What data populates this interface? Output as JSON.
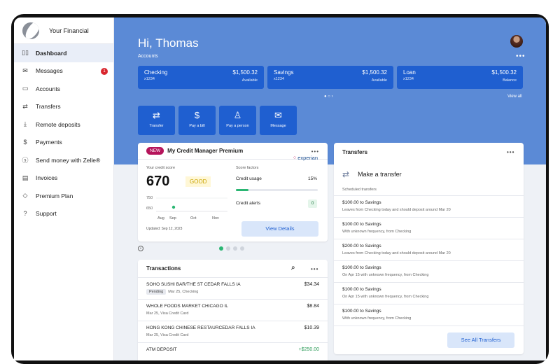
{
  "app": {
    "name": "Your Financial"
  },
  "sidebar": {
    "items": [
      {
        "label": "Dashboard",
        "icon": "dashboard-icon",
        "glyph": "▯▯"
      },
      {
        "label": "Messages",
        "icon": "mail-icon",
        "glyph": "✉",
        "badge": "1"
      },
      {
        "label": "Accounts",
        "icon": "wallet-icon",
        "glyph": "▭"
      },
      {
        "label": "Transfers",
        "icon": "transfer-icon",
        "glyph": "⇄"
      },
      {
        "label": "Remote deposits",
        "icon": "download-icon",
        "glyph": "⤓"
      },
      {
        "label": "Payments",
        "icon": "dollar-doc-icon",
        "glyph": "$"
      },
      {
        "label": "Send money with Zelle®",
        "icon": "zelle-icon",
        "glyph": "ⓢ"
      },
      {
        "label": "Invoices",
        "icon": "invoice-icon",
        "glyph": "▤"
      },
      {
        "label": "Premium Plan",
        "icon": "diamond-icon",
        "glyph": "◇"
      },
      {
        "label": "Support",
        "icon": "help-icon",
        "glyph": "?"
      }
    ]
  },
  "header": {
    "greeting": "Hi, Thomas",
    "accounts_label": "Accounts",
    "more": "•••"
  },
  "accounts": [
    {
      "name": "Checking",
      "id": "x1234",
      "balance": "$1,500.32",
      "sub": "Available"
    },
    {
      "name": "Savings",
      "id": "x1234",
      "balance": "$1,500.32",
      "sub": "Available"
    },
    {
      "name": "Loan",
      "id": "x1234",
      "balance": "$1,500.32",
      "sub": "Balance"
    }
  ],
  "accounts_pager": "● ○ ›",
  "view_all": "View all",
  "quick_actions": [
    {
      "label": "Transfer",
      "icon": "transfer-icon",
      "glyph": "⇄"
    },
    {
      "label": "Pay a bill",
      "icon": "bill-icon",
      "glyph": "$"
    },
    {
      "label": "Pay a person",
      "icon": "person-icon",
      "glyph": "♙"
    },
    {
      "label": "Message",
      "icon": "message-icon",
      "glyph": "✉"
    }
  ],
  "credit": {
    "badge": "NEW",
    "title": "My Credit Manager Premium",
    "brand": "experian",
    "score_label": "Your credit score",
    "score": "670",
    "rating": "GOOD",
    "factors_label": "Score factors",
    "chart": {
      "y_labels": [
        "750",
        "650"
      ],
      "x_labels": [
        "Aug",
        "Sep",
        "Oct",
        "Nov"
      ],
      "point": {
        "month": "Sep",
        "value": 670
      }
    },
    "factors": [
      {
        "name": "Credit usage",
        "value": "15%",
        "fill": 0.15
      },
      {
        "name": "Credit alerts",
        "value": "0"
      }
    ],
    "updated": "Updated: Sep 12, 2023",
    "button": "View Details",
    "pause": "II"
  },
  "transactions": {
    "title": "Transactions",
    "more": "•••",
    "rows": [
      {
        "desc": "SOHO SUSHI BAR/THE ST CEDAR FALLS IA",
        "status": "Pending",
        "meta": "Mar 25, Checking",
        "amount": "$34.34"
      },
      {
        "desc": "WHOLE FOODS MARKET CHICAGO IL",
        "meta": "Mar 25, Visa Credit Card",
        "amount": "$8.84"
      },
      {
        "desc": "HONG KONG CHINESE RESTAURCEDAR FALLS IA",
        "meta": "Mar 25, Visa Credit Card",
        "amount": "$10.39"
      },
      {
        "desc": "ATM DEPOSIT",
        "meta": "",
        "amount": "+$250.00"
      }
    ]
  },
  "transfers": {
    "title": "Transfers",
    "more": "•••",
    "make": "Make a transfer",
    "scheduled_label": "Scheduled transfers",
    "rows": [
      {
        "title": "$100.00 to Savings",
        "detail": "Leaves from Checking today and should deposit around Mar 20"
      },
      {
        "title": "$100.00 to Savings",
        "detail": "With unknown frequency, from Checking"
      },
      {
        "title": "$200.00 to Savings",
        "detail": "Leaves from Checking today and should deposit around Mar 20"
      },
      {
        "title": "$100.00 to Savings",
        "detail": "On Apr 15 with unknown frequency, from Checking"
      },
      {
        "title": "$100.00 to Savings",
        "detail": "On Apr 15 with unknown frequency, from Checking"
      },
      {
        "title": "$100.00 to Savings",
        "detail": "With unknown frequency, from Checking"
      }
    ],
    "button": "See All Transfers"
  }
}
